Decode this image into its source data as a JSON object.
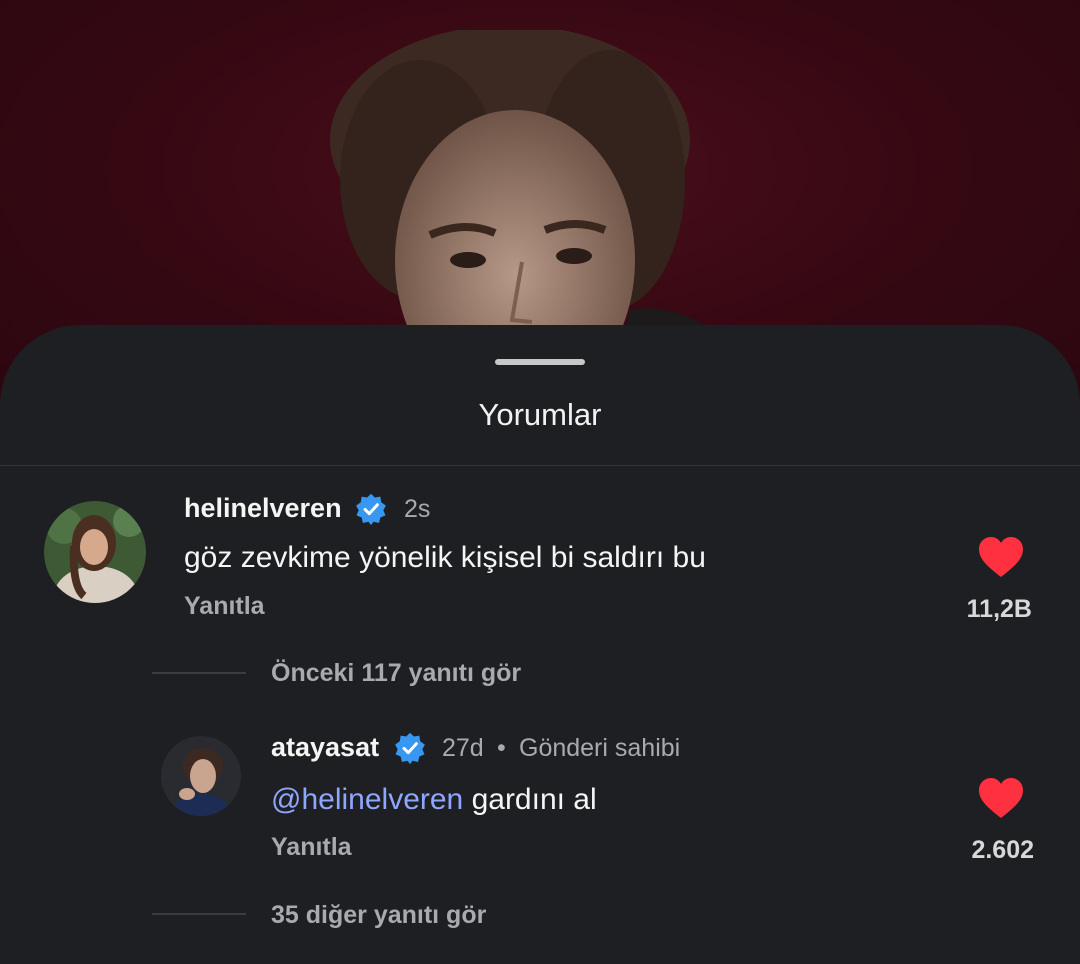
{
  "sheet": {
    "title": "Yorumlar"
  },
  "comment": {
    "username": "helinelveren",
    "age": "2s",
    "text": "göz zevkime yönelik kişisel bi saldırı bu",
    "reply_label": "Yanıtla",
    "likes": "11,2B",
    "view_previous": "Önceki 117 yanıtı gör"
  },
  "reply_comment": {
    "username": "atayasat",
    "age": "27d",
    "separator": "•",
    "author_tag": "Gönderi sahibi",
    "mention": "@helinelveren",
    "text": " gardını al",
    "reply_label": "Yanıtla",
    "likes": "2.602",
    "view_more": "35 diğer yanıtı gör"
  },
  "colors": {
    "background": "#3b0a15",
    "sheet": "#1e1f22",
    "heart": "#ff3040",
    "verified": "#3897f0",
    "mention": "#8fa6ff"
  }
}
